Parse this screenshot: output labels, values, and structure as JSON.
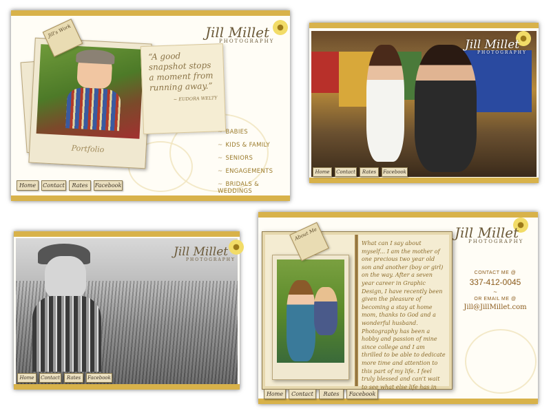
{
  "brand": {
    "name": "Jill Millet",
    "subtitle": "PHOTOGRAPHY"
  },
  "nav": [
    "Home",
    "Contact",
    "Rates",
    "Facebook"
  ],
  "panels": {
    "portfolio": {
      "tag_label": "Jill's Work",
      "polaroid_caption": "Portfolio",
      "quote": "“A good snapshot stops a moment from running away.”",
      "quote_author": "~ EUDORA WELTY",
      "menu": [
        "BABIES",
        "KIDS & FAMILY",
        "SENIORS",
        "ENGAGEMENTS",
        "BRIDALS & WEDDINGS"
      ]
    },
    "about": {
      "tag_label": "About Me",
      "text": "What can I say about myself... I am the mother of one precious two year old son and another (boy or girl) on the way. After a seven year career in Graphic Design, I have recently been given the pleasure of becoming a stay at home mom, thanks to God and a wonderful husband. Photography has been a hobby and passion of mine since college and I am thrilled to be able to dedicate more time and attention to this part of my life. I feel truly blessed and can't wait to see what else life has in store.",
      "contact_label": "CONTACT ME @",
      "phone": "337-412-0045",
      "tilde": "~",
      "email_label": "OR EMAIL ME @",
      "email": "Jill@JillMillet.com"
    }
  },
  "colors": {
    "accent_gold": "#d8b24a",
    "text_brown": "#8a6a2a"
  }
}
